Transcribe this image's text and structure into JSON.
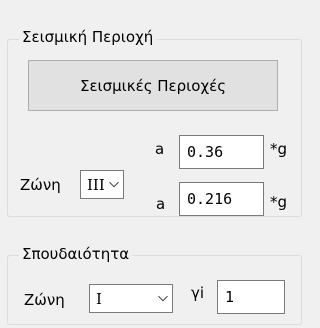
{
  "seismic_group": {
    "title": "Σεισμική Περιοχή",
    "button_label": "Σεισμικές Περιοχές",
    "zone_label": "Ζώνη",
    "zone_value": "III",
    "a_label_1": "a",
    "a_value_1": "0.36",
    "unit_1": "*g",
    "a_label_2": "a",
    "a_value_2": "0.216",
    "unit_2": "*g"
  },
  "importance_group": {
    "title": "Σπουδαιότητα",
    "zone_label": "Ζώνη",
    "zone_value": "I",
    "gamma_label": "γi",
    "gamma_value": "1"
  },
  "icons": {
    "dropdown": "chevron-down-icon"
  }
}
